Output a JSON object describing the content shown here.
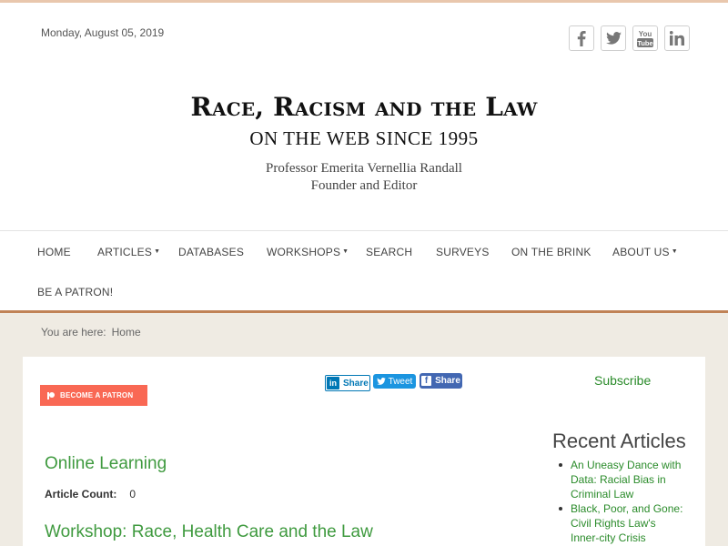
{
  "header": {
    "date": "Monday, August 05, 2019",
    "site_title": "Race, Racism and the Law",
    "site_subtitle": "ON THE WEB SINCE 1995",
    "professor": "Professor Emerita Vernellia Randall",
    "role": "Founder and Editor",
    "social": [
      {
        "icon": "facebook-icon"
      },
      {
        "icon": "twitter-icon"
      },
      {
        "icon": "youtube-icon",
        "label": "You Tube"
      },
      {
        "icon": "linkedin-icon"
      }
    ]
  },
  "nav": {
    "items": [
      {
        "label": "HOME"
      },
      {
        "label": "ARTICLES",
        "has_dropdown": true
      },
      {
        "label": "DATABASES"
      },
      {
        "label": "WORKSHOPS",
        "has_dropdown": true
      },
      {
        "label": "SEARCH"
      },
      {
        "label": "SURVEYS"
      },
      {
        "label": "ON THE BRINK"
      },
      {
        "label": "ABOUT US",
        "has_dropdown": true
      },
      {
        "label": "BE A PATRON!"
      }
    ],
    "caret": "▼"
  },
  "breadcrumb": {
    "prefix": "You are here:",
    "current": "Home"
  },
  "sharing": {
    "patron_button": "BECOME A PATRON",
    "linkedin_label": "Share",
    "linkedin_icon_text": "in",
    "tweet_label": "Tweet",
    "facebook_label": "Share",
    "facebook_icon_text": "f",
    "subscribe": "Subscribe"
  },
  "main": {
    "section1_title": "Online Learning",
    "article_count_label": "Article Count:",
    "article_count_value": "0",
    "section2_title": "Workshop: Race, Health Care and the Law"
  },
  "sidebar": {
    "title": "Recent Articles",
    "articles": [
      "An Uneasy Dance with Data: Racial Bias in Criminal Law",
      "Black, Poor, and Gone: Civil Rights Law's Inner-city Crisis"
    ]
  },
  "colors": {
    "accent_green": "#3f9a3f",
    "nav_border": "#c08256",
    "patron_red": "#f96854",
    "linkedin_blue": "#0077b5",
    "twitter_blue": "#1b95e0",
    "facebook_blue": "#4267b2",
    "page_bg": "#efebe3"
  }
}
